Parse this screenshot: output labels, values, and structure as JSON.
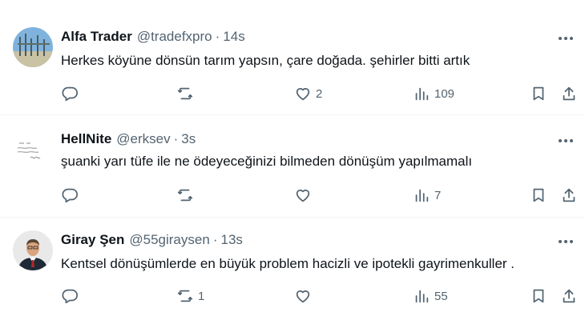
{
  "tweets": [
    {
      "author": "Alfa Trader",
      "handle": "@tradefxpro",
      "separator": "·",
      "time": "14s",
      "text": "Herkes köyüne dönsün tarım yapsın, çare doğada. şehirler bitti artık",
      "replies": "",
      "retweets": "",
      "likes": "2",
      "views": "109"
    },
    {
      "author": "HellNite",
      "handle": "@erksev",
      "separator": "·",
      "time": "3s",
      "text": "şuanki yarı tüfe ile ne ödeyeceğinizi bilmeden dönüşüm yapılmamalı",
      "replies": "",
      "retweets": "",
      "likes": "",
      "views": "7"
    },
    {
      "author": "Giray Şen",
      "handle": "@55giraysen",
      "separator": "·",
      "time": "13s",
      "text": "Kentsel dönüşümlerde en büyük problem hacizli ve ipotekli gayrimenkuller .",
      "replies": "",
      "retweets": "1",
      "likes": "",
      "views": "55"
    }
  ],
  "icons": {
    "reply": "reply-icon",
    "retweet": "retweet-icon",
    "like": "heart-icon",
    "views": "views-icon",
    "bookmark": "bookmark-icon",
    "share": "share-icon",
    "more": "more-icon"
  },
  "colors": {
    "text": "#0f1419",
    "secondary": "#536471",
    "divider": "#eff3f4"
  }
}
